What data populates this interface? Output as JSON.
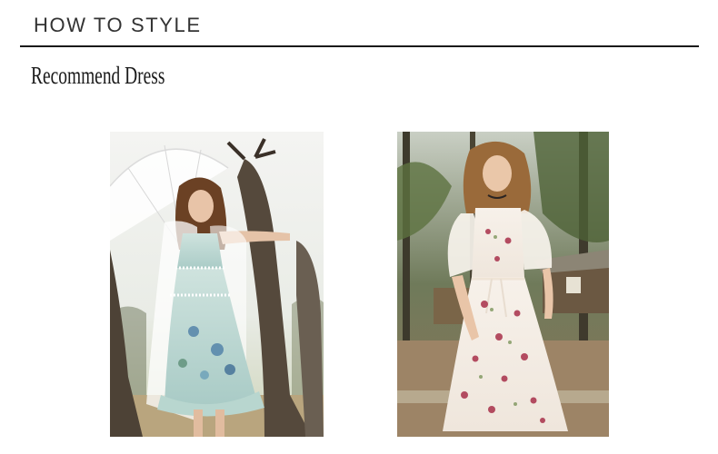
{
  "header": {
    "title": "HOW TO STYLE",
    "subtitle": "Recommend Dress"
  },
  "gallery": {
    "items": [
      {
        "image": "model-in-light-blue-floral-dress-with-lace-parasol"
      },
      {
        "image": "model-in-white-floral-lace-midi-dress-in-forest"
      }
    ]
  },
  "colors": {
    "text": "#333333",
    "rule": "#1a1a1a",
    "background": "#ffffff"
  }
}
